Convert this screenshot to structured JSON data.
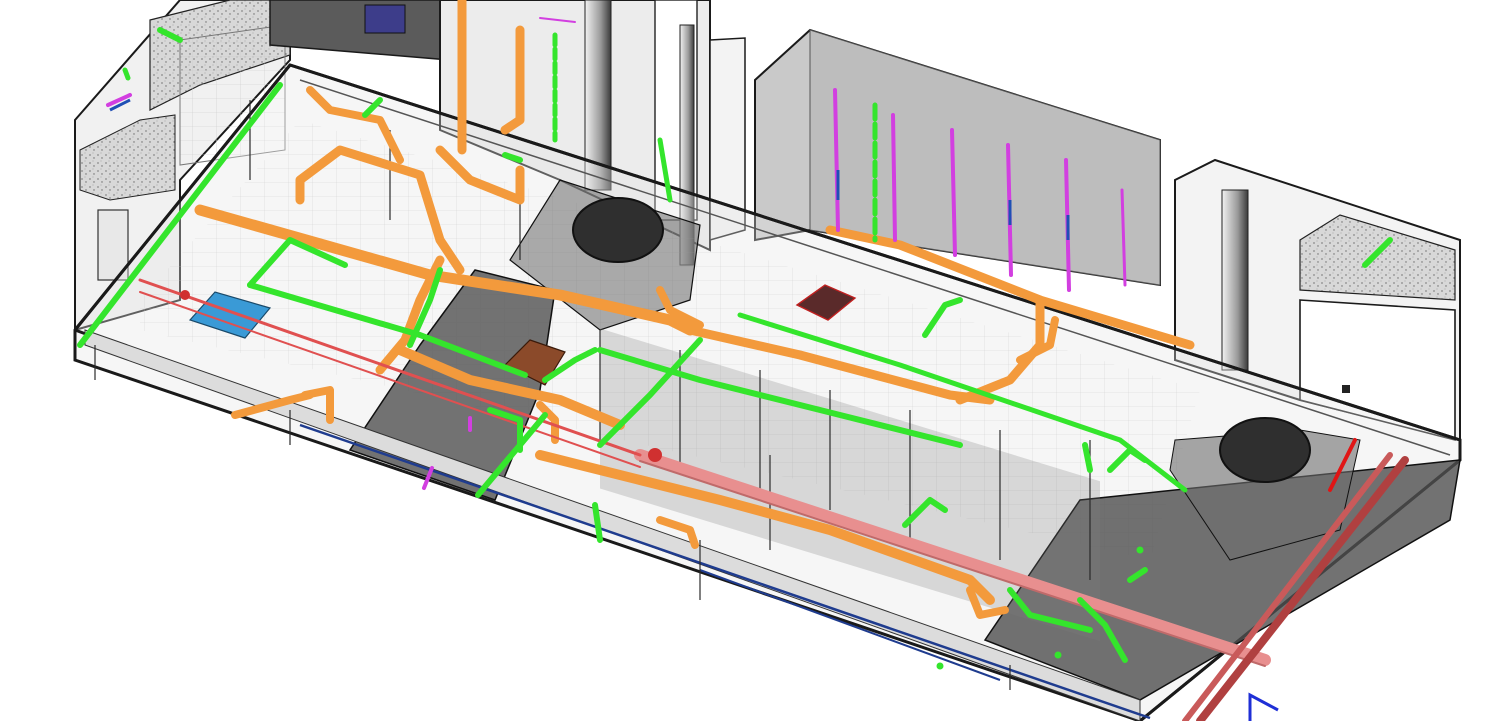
{
  "view": {
    "kind": "isometric-bim-model",
    "background": "#ffffff"
  },
  "systems": [
    {
      "name": "sanitary-drain-pipe",
      "color": "#f39a3c"
    },
    {
      "name": "domestic-water-pipe",
      "color": "#34e52c"
    },
    {
      "name": "fire-protection-pipe",
      "color": "#e88f8f"
    },
    {
      "name": "riser-pipe",
      "color": "#d23fe0"
    },
    {
      "name": "structure-slab",
      "color": "#5a5a5a"
    },
    {
      "name": "wall-outline",
      "color": "#1a1a1a"
    },
    {
      "name": "grade-line",
      "color": "#1f3c8f"
    }
  ],
  "icons": [
    "view-cube-corner-icon"
  ]
}
